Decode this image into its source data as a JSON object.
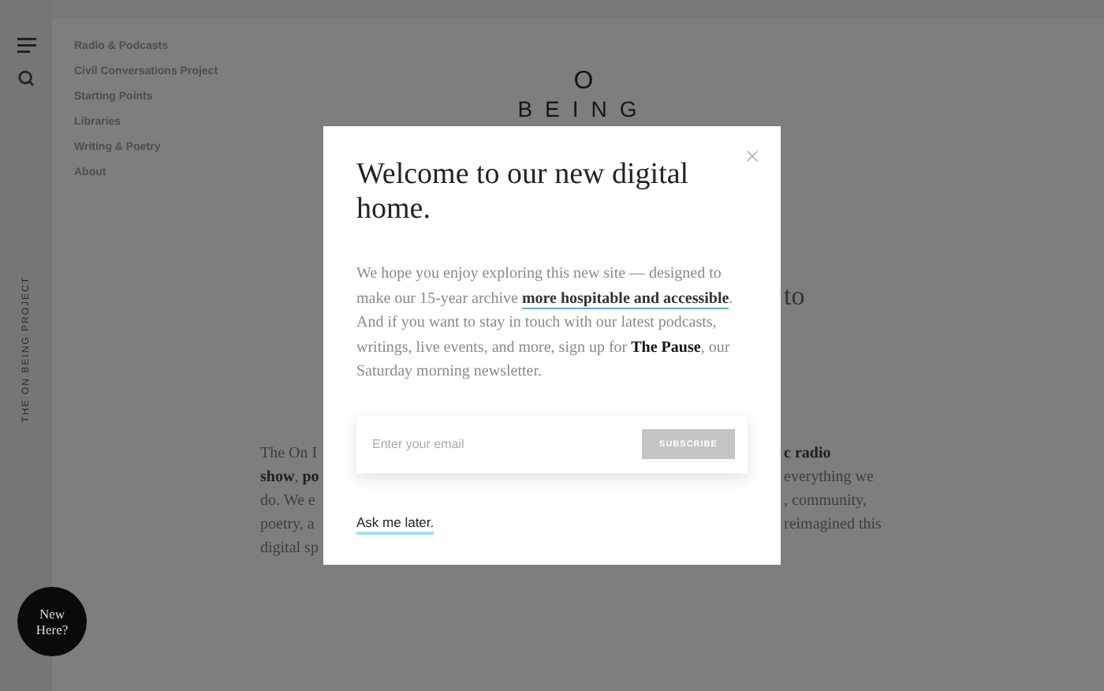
{
  "rail": {
    "vertical_label": "THE ON BEING PROJECT"
  },
  "nav": {
    "items": [
      "Radio & Podcasts",
      "Civil Conversations Project",
      "Starting Points",
      "Libraries",
      "Writing & Poetry",
      "About"
    ]
  },
  "logo": {
    "mark": "O",
    "word": "BEING"
  },
  "hero_fragment": "to",
  "background_text": {
    "left": [
      "The On I",
      "**show**, **po**",
      "do. We e",
      "poetry, a",
      "digital sp"
    ],
    "right": [
      "**c radio**",
      "everything we",
      ", community,",
      "reimagined this"
    ]
  },
  "dialog": {
    "title": "Welcome to our new digital home.",
    "body_start": "We hope you enjoy exploring this new site — designed to make our 15-year archive ",
    "link": "more hospitable and accessible",
    "body_end": ". And if you want to stay in touch with our latest podcasts, writings, live events, and more, sign up for **The Pause**, our Saturday morning newsletter.",
    "email": {
      "placeholder": "Enter your email"
    },
    "subscribe": "SUBSCRIBE",
    "later": "Ask me later."
  },
  "new_here": "New Here?"
}
